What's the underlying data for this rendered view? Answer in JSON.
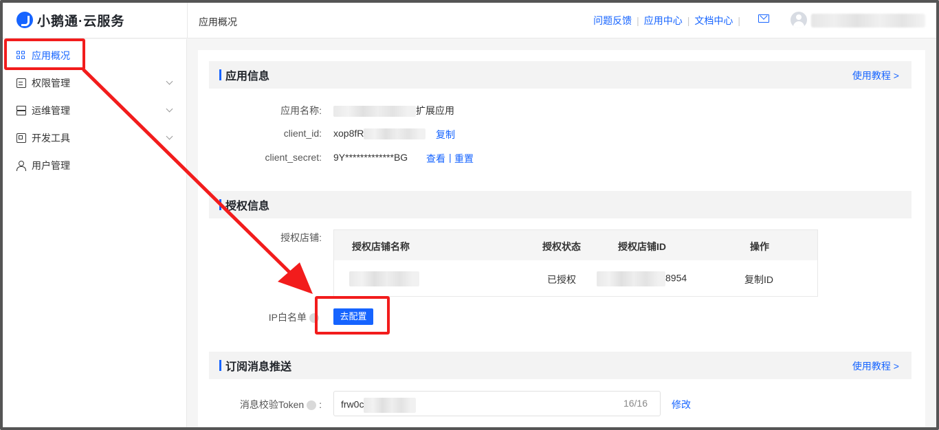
{
  "app": {
    "logo_text": "小鹅通·云服务",
    "breadcrumb": "应用概况"
  },
  "top_links": [
    {
      "label": "问题反馈"
    },
    {
      "label": "应用中心"
    },
    {
      "label": "文档中心"
    }
  ],
  "top_icons": {
    "mail": "mail-icon",
    "avatar": "avatar"
  },
  "sidebar": {
    "items": [
      {
        "label": "应用概况",
        "icon": "grid-icon",
        "active": true
      },
      {
        "label": "权限管理",
        "icon": "document-icon",
        "expandable": true
      },
      {
        "label": "运维管理",
        "icon": "server-icon",
        "expandable": true
      },
      {
        "label": "开发工具",
        "icon": "toolbox-icon",
        "expandable": true
      },
      {
        "label": "用户管理",
        "icon": "user-icon"
      }
    ]
  },
  "app_info": {
    "title": "应用信息",
    "tutorial_link": "使用教程 >",
    "name_label": "应用名称:",
    "name_value": "扩展应用",
    "client_id_label": "client_id:",
    "client_id_value": "xop8fR",
    "copy_label": "复制",
    "client_secret_label": "client_secret:",
    "client_secret_value": "9Y*************BG",
    "view_label": "查看",
    "divider": "|",
    "reset_label": "重置"
  },
  "auth_info": {
    "title": "授权信息",
    "store_label": "授权店铺:",
    "columns": [
      "授权店铺名称",
      "授权状态",
      "授权店铺ID",
      "操作"
    ],
    "rows": [
      {
        "name": "",
        "status": "已授权",
        "store_id": "8954",
        "action": "复制ID"
      }
    ],
    "ip_whitelist_label": "IP白名单",
    "configure_button": "去配置"
  },
  "subscription": {
    "title": "订阅消息推送",
    "tutorial_link": "使用教程 >",
    "token_label": "消息校验Token",
    "token_colon": ":",
    "token_value": "frw0c",
    "token_count": "16/16",
    "edit_label": "修改"
  },
  "colors": {
    "accent": "#1664ff",
    "annotation_red": "#f21c1c",
    "section_bg": "#f3f3f3"
  }
}
